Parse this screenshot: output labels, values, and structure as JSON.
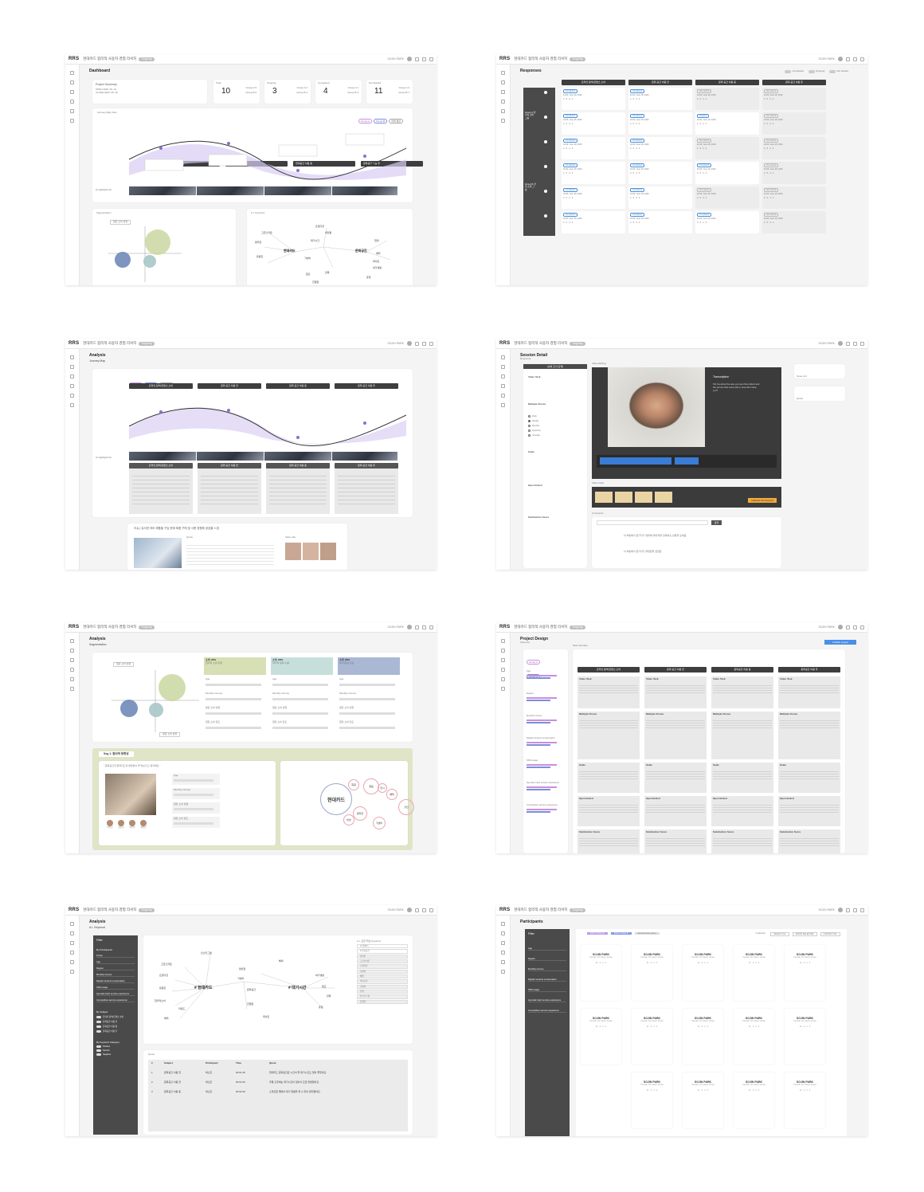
{
  "app": {
    "logo": "RRS",
    "project_title": "현대카드 합리적 사용자 경험 리서치",
    "status_pill": "Ongoing",
    "user_name": "SOJIN PARK"
  },
  "s1": {
    "title": "Dashboard",
    "summary_title": "Project Summary",
    "summary_open": "OPEN 2020. 06. 10",
    "summary_close": "CLOSE 2020. 06. 30",
    "stats": [
      {
        "label": "Total",
        "value": "10",
        "g1": "Group A 5",
        "g2": "Group B 5"
      },
      {
        "label": "Ongoing",
        "value": "3",
        "g1": "Group A 2",
        "g2": "Group B 1"
      },
      {
        "label": "Completed",
        "value": "4",
        "g1": "Group A 1",
        "g2": "Group B 3"
      },
      {
        "label": "Not Started",
        "value": "11",
        "g1": "Group A 4",
        "g2": "Group B 7"
      }
    ],
    "journey_title": "Journey Map View",
    "filters": [
      "Group A",
      "Group B",
      "전체 평균"
    ],
    "stages": [
      "온라인 탐색/콘텐츠 소비",
      "현대공간 이용 전",
      "현대공간 이용 중",
      "문화공간 이용 후"
    ],
    "ai_label": "AI Highlight list",
    "seg_title": "Segmentation",
    "seg_select": "젊은 소비 성향",
    "segments": [
      {
        "title": "소비, 88%",
        "text": "합리적 소비 지향"
      },
      {
        "title": "소비, 88%",
        "text": "적극적 문화 수용"
      },
      {
        "title": "소비, 88%",
        "text": "여가/문화 관심"
      }
    ],
    "kw_title": "A.I. Keyword",
    "keywords": [
      "현대카드",
      "문화공간",
      "고급스러운",
      "편리한",
      "유용한",
      "대기시간",
      "가성비",
      "현대",
      "트렌디한",
      "배려",
      "여가생활",
      "데이트",
      "휴일",
      "접근",
      "친절함",
      "세련됨",
      "만족"
    ]
  },
  "s2": {
    "title": "Responses",
    "toggles": [
      "Completed",
      "Ongoing",
      "Not started"
    ],
    "stages": [
      "온라인 탐색/콘텐츠 소비",
      "문화 공간 이용 전",
      "문화 공간 이용 중",
      "문화 공간 이용 후"
    ],
    "groups": [
      "Group A 합리적 소비 그룹",
      "Group B 경험 소비 그룹"
    ],
    "status_completed": "Completed",
    "status_ongoing": "Ongoing",
    "status_not": "Not started",
    "date": "10:00, June 18, 2020",
    "counts": "2 · 5 · 4 · 4"
  },
  "s3": {
    "title": "Analysis",
    "sub": "Journey Map",
    "filters": [
      "Group A",
      "Group B",
      "전체 평균"
    ],
    "stages": [
      "온라인 탐색/콘텐츠 소비",
      "문화 공간 이용 전",
      "문화 공간 이용 중",
      "문화 공간 이용 후"
    ],
    "ai_label": "AI Highlight list",
    "insight_title": "이슈 | 유사한 여러 제품을 구입 현재 제품 구매 및 사용 경험에 공감을 느낌",
    "quote_label": "Quote",
    "clip_label": "Video clip"
  },
  "s4": {
    "title": "Session Detail",
    "resp": "Response",
    "tab": "(상처 조사 단계)",
    "tasks": [
      "Video Task",
      "Multiple Choice",
      "Scale",
      "Open Ended",
      "Satisfaction Score"
    ],
    "options": [
      "Daily",
      "Weekly",
      "Monthly",
      "Quarterly",
      "Annually"
    ],
    "video_label": "Video Editing",
    "transcript_title": "Transcription",
    "transcript": "Tell me about the way you use this product and the service that came with it. How did it help you?",
    "clips_label": "Video Clips",
    "clip_btn": "Highlight this Keyword",
    "comments_label": "Comments",
    "comment_btn": "등록",
    "comments": [
      "이 부분에서 참가자가 영화에 대해 매우 만족하는 반응을 보여줌",
      "이 부분에서 참가자가 불편함을 표현함"
    ],
    "side1": "Issue List",
    "side2": "Quote"
  },
  "s5": {
    "title": "Analysis",
    "sub": "Segmentation",
    "select": "젊은 소비 성향",
    "select2": "젊은 소비 성향",
    "segs": [
      {
        "title": "소비, 88%",
        "text": "합리적 소비 지향"
      },
      {
        "title": "소비, 88%",
        "text": "적극적 문화 수용"
      },
      {
        "title": "소비, 88%",
        "text": "여가/문화 관심"
      }
    ],
    "attrs": [
      "Age",
      "Monthly income",
      "젊은 소비 성향",
      "젊은 소비 만도"
    ],
    "seg_detail": "Seg 1. 합리적 방향성",
    "quote": "\" 문화공간과 현대카드의 방향성이 잘 맞는다고 생각해요 \"",
    "bubbles": [
      "현대카드",
      "젊음",
      "할인",
      "편리한",
      "회원",
      "혜택",
      "전시",
      "가성비",
      "비싼"
    ],
    "persons": [
      "박소진",
      "김은지",
      "이수민",
      "최유진"
    ]
  },
  "s6": {
    "title": "Project Design",
    "screener": "Screener",
    "task_scenario": "Task Scenario",
    "publish": "Publish project",
    "groups": [
      "Group A",
      "Group B"
    ],
    "criteria": [
      "Age",
      "Region",
      "Monthly income",
      "Digital contents consumption",
      "SNS usage",
      "Hyundai Card service experience",
      "Competitive service experience"
    ],
    "stages": [
      "온라인 탐색/콘텐츠 소비",
      "문화 공간 이용 전",
      "문화공간 이용 중",
      "문화공간 이용 후"
    ],
    "tasks": [
      "Video Task",
      "Multiple Choice",
      "Scale",
      "Open Ended",
      "Satisfaction Score"
    ]
  },
  "s7": {
    "title": "Analysis",
    "sub": "A.I. Keyword",
    "filter": "Filter",
    "side_title": "By Participants",
    "side_items": [
      "Group",
      "Age",
      "Region",
      "Monthly income",
      "Digital contents consumption",
      "SNS usage",
      "Hyundai Card service experience",
      "Competitive service experience"
    ],
    "subject_title": "By Subject",
    "subjects": [
      "온라인 탐색/콘텐츠 소비",
      "문화공간 이용 전",
      "문화공간 이용 중",
      "문화공간 이용 후"
    ],
    "cat_title": "By Keyword Category",
    "cats": [
      "Positive",
      "Neutral",
      "Negative"
    ],
    "hub1": "# 현대카드",
    "hub2": "# 대기시간",
    "words": [
      "인스타그램",
      "고급스러운",
      "트렌디한",
      "유용한",
      "합리적소비",
      "리워드",
      "배려",
      "편안함",
      "가성비",
      "문화공간",
      "친절함",
      "데이트",
      "혜택",
      "여가생활",
      "접근",
      "휴일",
      "만족"
    ],
    "list_title": "A.I. 포함 핵심 Keyword",
    "list": [
      "# 현대카드",
      "# 문화공간",
      "편리한",
      "고급스러운",
      "트렌디한",
      "가성비",
      "혜택",
      "대기시간",
      "가성비",
      "만족",
      "인스타그램",
      "친절함"
    ],
    "quote_title": "Quote",
    "cols": [
      "#",
      "Subject",
      "Participant",
      "Time",
      "Quote"
    ],
    "rows": [
      {
        "n": "1",
        "subj": "문화공간 이용 전",
        "p": "박소진",
        "t": "00:01:28",
        "q": "현대카드 문화공간은 시간이 잘 대기시간도 없어 좋았어요."
      },
      {
        "n": "2",
        "subj": "문화공간 이용 전",
        "p": "박소진",
        "t": "00:01:50",
        "q": "주말 오후에는 대기시간이 길어서 조금 불편했어요."
      },
      {
        "n": "3",
        "subj": "문화공간 이용 중",
        "p": "박소진",
        "t": "00:02:30",
        "q": "스마트폰 앱에서 대기 현황을 볼 수 있어 편리했어요."
      }
    ]
  },
  "s8": {
    "title": "Participants",
    "filter": "Filter",
    "filters": [
      "Age",
      "Region",
      "Monthly income",
      "Digital contents consumption",
      "SNS usage",
      "Hyundai Card service experience",
      "Competitive service experience"
    ],
    "tags": [
      "Add to Group A",
      "Add to Group B",
      "Remove from group"
    ],
    "sort": [
      "6 selected",
      "SELECT ALL",
      "INVITE SELECTED",
      "CONTACT ALL"
    ],
    "name": "SOJIN PARK",
    "info": "Female, 33, Seoul, Korea",
    "stats": "11 · 3 · 2 · 4"
  }
}
